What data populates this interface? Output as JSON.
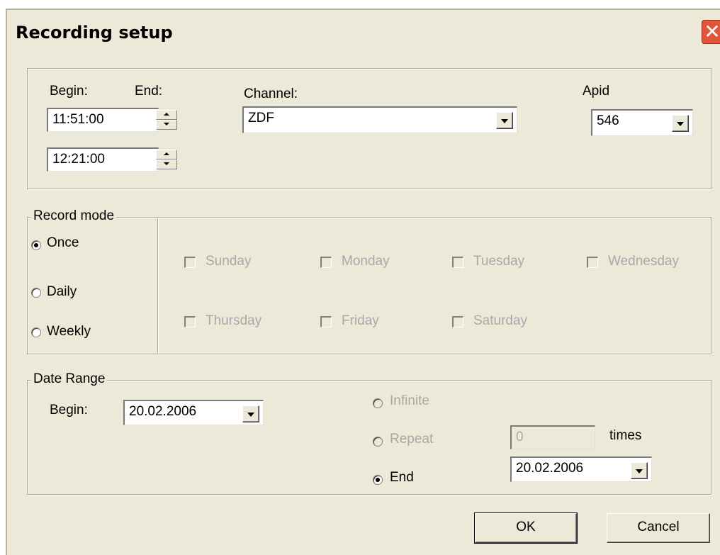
{
  "window": {
    "title": "Recording setup",
    "close": "✕"
  },
  "time": {
    "begin_label": "Begin:",
    "end_label": "End:",
    "begin_value": "11:51:00",
    "end_value": "12:21:00"
  },
  "channel": {
    "label": "Channel:",
    "value": "ZDF"
  },
  "apid": {
    "label": "Apid",
    "value": "546"
  },
  "record_mode": {
    "legend": "Record mode",
    "options": [
      {
        "label": "Once",
        "checked": true
      },
      {
        "label": "Daily",
        "checked": false
      },
      {
        "label": "Weekly",
        "checked": false
      }
    ],
    "days": [
      "Sunday",
      "Monday",
      "Tuesday",
      "Wednesday",
      "Thursday",
      "Friday",
      "Saturday"
    ]
  },
  "date_range": {
    "legend": "Date Range",
    "begin_label": "Begin:",
    "begin_value": "20.02.2006",
    "infinite_label": "Infinite",
    "repeat_label": "Repeat",
    "repeat_value": "0",
    "times_label": "times",
    "end_label": "End",
    "end_value": "20.02.2006"
  },
  "buttons": {
    "ok": "OK",
    "cancel": "Cancel"
  }
}
